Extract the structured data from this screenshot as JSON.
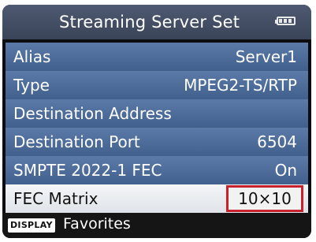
{
  "header": {
    "title": "Streaming Server Set",
    "icon": "battery-icon"
  },
  "rows": [
    {
      "label": "Alias",
      "value": "Server1"
    },
    {
      "label": "Type",
      "value": "MPEG2-TS/RTP"
    },
    {
      "label": "Destination Address",
      "value": ""
    },
    {
      "label": "Destination Port",
      "value": "6504"
    },
    {
      "label": "SMPTE 2022-1 FEC",
      "value": "On"
    },
    {
      "label": "FEC Matrix",
      "value": "10×10",
      "selected": true
    }
  ],
  "footer": {
    "badge": "DISPLAY",
    "label": "Favorites"
  },
  "colors": {
    "highlight": "#c8232c",
    "row": "#4f6e9c",
    "header": "#454f66"
  }
}
